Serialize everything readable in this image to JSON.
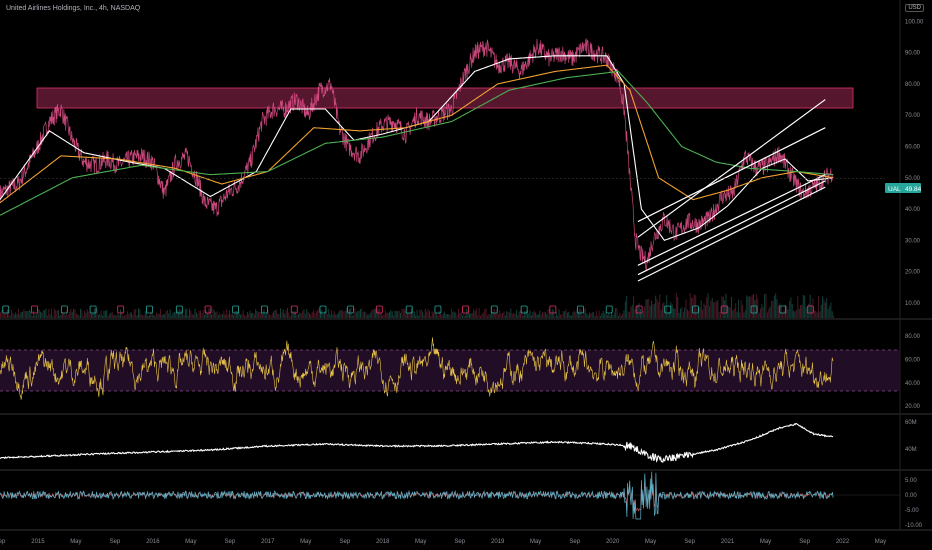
{
  "header": {
    "title": "United Airlines Holdings, Inc., 4h, NASDAQ",
    "currency": "USD"
  },
  "price_tag": {
    "symbol": "UAL",
    "value": "49.84"
  },
  "chart_data": {
    "type": "line",
    "title": "United Airlines Holdings, Inc., 4h, NASDAQ",
    "x_ticks": [
      "Sep",
      "2015",
      "May",
      "Sep",
      "2016",
      "May",
      "Sep",
      "2017",
      "May",
      "Sep",
      "2018",
      "May",
      "Sep",
      "2019",
      "May",
      "Sep",
      "2020",
      "May",
      "Sep",
      "2021",
      "May",
      "Sep",
      "2022",
      "May"
    ],
    "x_tick_dates": [
      2014.67,
      2015.0,
      2015.33,
      2015.67,
      2016.0,
      2016.33,
      2016.67,
      2017.0,
      2017.33,
      2017.67,
      2018.0,
      2018.33,
      2018.67,
      2019.0,
      2019.33,
      2019.67,
      2020.0,
      2020.33,
      2020.67,
      2021.0,
      2021.33,
      2021.67,
      2022.0,
      2022.33
    ],
    "x_range": [
      2014.67,
      2022.5
    ],
    "panels": [
      {
        "name": "price",
        "y_ticks": [
          "100.00",
          "90.00",
          "80.00",
          "70.00",
          "60.00",
          "50.00",
          "40.00",
          "30.00",
          "20.00",
          "10.00"
        ],
        "ylim": [
          9,
          103
        ],
        "series": [
          {
            "role": "price",
            "color": "#e0508a",
            "points": [
              [
                2014.67,
                45
              ],
              [
                2014.83,
                48
              ],
              [
                2015.0,
                60
              ],
              [
                2015.1,
                68
              ],
              [
                2015.2,
                72
              ],
              [
                2015.3,
                62
              ],
              [
                2015.4,
                55
              ],
              [
                2015.5,
                54
              ],
              [
                2015.6,
                56
              ],
              [
                2015.7,
                54
              ],
              [
                2015.8,
                56
              ],
              [
                2015.9,
                57
              ],
              [
                2016.0,
                55
              ],
              [
                2016.1,
                45
              ],
              [
                2016.2,
                55
              ],
              [
                2016.3,
                57
              ],
              [
                2016.4,
                48
              ],
              [
                2016.45,
                42
              ],
              [
                2016.55,
                40
              ],
              [
                2016.65,
                45
              ],
              [
                2016.75,
                48
              ],
              [
                2016.85,
                55
              ],
              [
                2016.95,
                68
              ],
              [
                2017.05,
                72
              ],
              [
                2017.15,
                72
              ],
              [
                2017.25,
                75
              ],
              [
                2017.35,
                70
              ],
              [
                2017.45,
                78
              ],
              [
                2017.55,
                80
              ],
              [
                2017.62,
                66
              ],
              [
                2017.7,
                60
              ],
              [
                2017.8,
                57
              ],
              [
                2017.9,
                63
              ],
              [
                2018.0,
                67
              ],
              [
                2018.1,
                68
              ],
              [
                2018.2,
                64
              ],
              [
                2018.3,
                70
              ],
              [
                2018.4,
                68
              ],
              [
                2018.5,
                70
              ],
              [
                2018.6,
                72
              ],
              [
                2018.7,
                82
              ],
              [
                2018.8,
                90
              ],
              [
                2018.9,
                92
              ],
              [
                2019.0,
                86
              ],
              [
                2019.1,
                87
              ],
              [
                2019.2,
                84
              ],
              [
                2019.35,
                92
              ],
              [
                2019.45,
                88
              ],
              [
                2019.55,
                90
              ],
              [
                2019.65,
                88
              ],
              [
                2019.75,
                92
              ],
              [
                2019.85,
                90
              ],
              [
                2019.95,
                88
              ],
              [
                2020.05,
                82
              ],
              [
                2020.1,
                72
              ],
              [
                2020.15,
                50
              ],
              [
                2020.2,
                30
              ],
              [
                2020.25,
                25
              ],
              [
                2020.3,
                23
              ],
              [
                2020.35,
                30
              ],
              [
                2020.45,
                37
              ],
              [
                2020.55,
                32
              ],
              [
                2020.65,
                36
              ],
              [
                2020.75,
                35
              ],
              [
                2020.85,
                37
              ],
              [
                2020.95,
                44
              ],
              [
                2021.05,
                45
              ],
              [
                2021.15,
                57
              ],
              [
                2021.25,
                53
              ],
              [
                2021.35,
                54
              ],
              [
                2021.45,
                58
              ],
              [
                2021.55,
                51
              ],
              [
                2021.65,
                45
              ],
              [
                2021.75,
                47
              ],
              [
                2021.85,
                50
              ],
              [
                2021.92,
                52
              ]
            ]
          },
          {
            "role": "ma-fast",
            "color": "#ffffff",
            "points": [
              [
                2014.67,
                43
              ],
              [
                2015.1,
                65
              ],
              [
                2015.4,
                58
              ],
              [
                2015.8,
                55
              ],
              [
                2016.1,
                53
              ],
              [
                2016.5,
                44
              ],
              [
                2016.9,
                52
              ],
              [
                2017.2,
                72
              ],
              [
                2017.5,
                72
              ],
              [
                2017.75,
                62
              ],
              [
                2018.0,
                64
              ],
              [
                2018.4,
                68
              ],
              [
                2018.8,
                84
              ],
              [
                2019.1,
                88
              ],
              [
                2019.5,
                89
              ],
              [
                2019.95,
                89
              ],
              [
                2020.1,
                80
              ],
              [
                2020.25,
                40
              ],
              [
                2020.45,
                30
              ],
              [
                2020.75,
                34
              ],
              [
                2021.0,
                41
              ],
              [
                2021.3,
                53
              ],
              [
                2021.5,
                56
              ],
              [
                2021.7,
                49
              ],
              [
                2021.92,
                50
              ]
            ]
          },
          {
            "role": "ma-mid",
            "color": "#f0a030",
            "points": [
              [
                2014.67,
                42
              ],
              [
                2015.2,
                57
              ],
              [
                2015.7,
                56
              ],
              [
                2016.2,
                53
              ],
              [
                2016.6,
                48
              ],
              [
                2017.0,
                52
              ],
              [
                2017.4,
                66
              ],
              [
                2017.8,
                65
              ],
              [
                2018.2,
                66
              ],
              [
                2018.6,
                70
              ],
              [
                2019.0,
                80
              ],
              [
                2019.5,
                84
              ],
              [
                2019.95,
                86
              ],
              [
                2020.15,
                78
              ],
              [
                2020.4,
                50
              ],
              [
                2020.7,
                43
              ],
              [
                2021.0,
                46
              ],
              [
                2021.3,
                50
              ],
              [
                2021.6,
                52
              ],
              [
                2021.92,
                50
              ]
            ]
          },
          {
            "role": "ma-slow",
            "color": "#4caf50",
            "points": [
              [
                2014.67,
                38
              ],
              [
                2015.3,
                50
              ],
              [
                2015.9,
                54
              ],
              [
                2016.5,
                51
              ],
              [
                2017.0,
                52
              ],
              [
                2017.5,
                61
              ],
              [
                2018.0,
                63
              ],
              [
                2018.6,
                68
              ],
              [
                2019.1,
                78
              ],
              [
                2019.6,
                82
              ],
              [
                2020.05,
                84
              ],
              [
                2020.3,
                74
              ],
              [
                2020.6,
                60
              ],
              [
                2020.9,
                55
              ],
              [
                2021.2,
                53
              ],
              [
                2021.6,
                52
              ],
              [
                2021.92,
                51
              ]
            ]
          }
        ]
      },
      {
        "name": "rsi",
        "y_ticks": [
          "80.00",
          "60.00",
          "40.00",
          "20.00"
        ],
        "ylim": [
          15,
          92
        ],
        "band": [
          30,
          70
        ],
        "series": [
          {
            "role": "rsi",
            "color": "#e8c547",
            "mean": 52,
            "amplitude": 18
          }
        ]
      },
      {
        "name": "indicator-2",
        "y_ticks": [
          "60M",
          "40M"
        ],
        "series": [
          {
            "role": "line",
            "color": "#ffffff"
          }
        ]
      },
      {
        "name": "indicator-3",
        "y_ticks": [
          "5.00",
          "0.00",
          "-5.00",
          "-10.00"
        ],
        "ylim": [
          -11,
          7
        ],
        "series": [
          {
            "role": "osc",
            "color": "#5fb0c8"
          }
        ]
      }
    ],
    "annotations": [
      {
        "type": "zone",
        "color": "#e0306a",
        "y": [
          74,
          80
        ]
      },
      {
        "type": "channel",
        "color": "#ffffff",
        "note": "parallel rising lines 2020-2021"
      }
    ]
  }
}
